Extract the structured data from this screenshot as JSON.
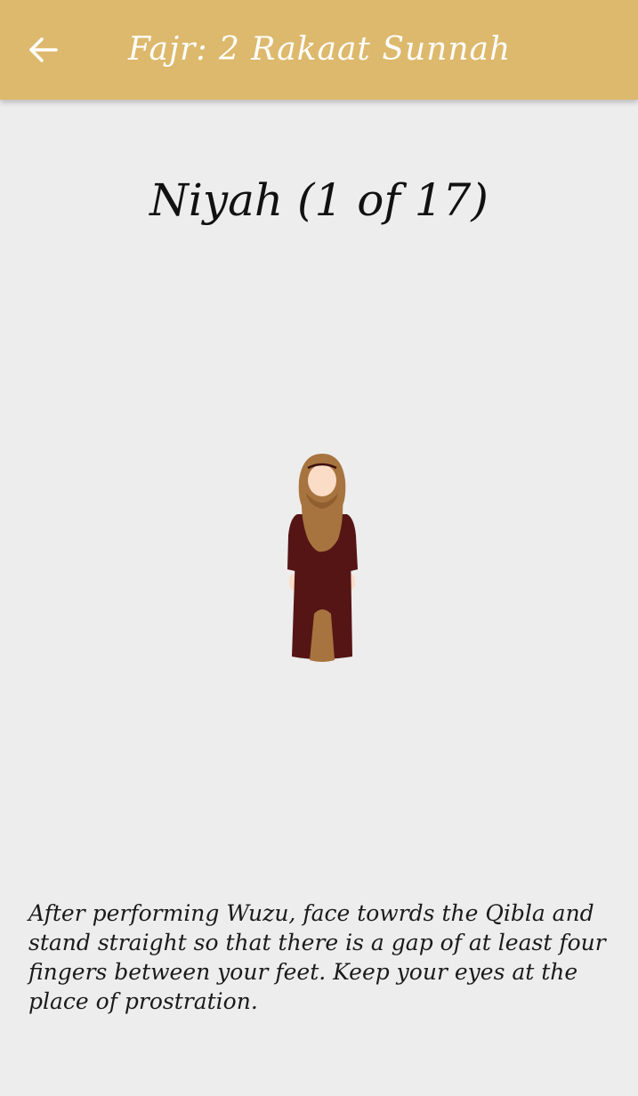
{
  "app_bar": {
    "back_icon": "arrow-left-icon",
    "title": "Fajr: 2 Rakaat Sunnah",
    "background_color": "#ddb96d",
    "text_color": "#ffffff"
  },
  "step": {
    "title": "Niyah (1 of 17)",
    "illustration": "standing-woman-hijab-illustration",
    "description": "After performing Wuzu, face towrds the Qibla and stand straight so that there is a gap of at least four fingers between your feet. Keep your eyes at the place of prostration."
  },
  "colors": {
    "page_background": "#eeeded",
    "hijab": "#a7743f",
    "dress": "#561515",
    "skin": "#fbdcc7"
  }
}
